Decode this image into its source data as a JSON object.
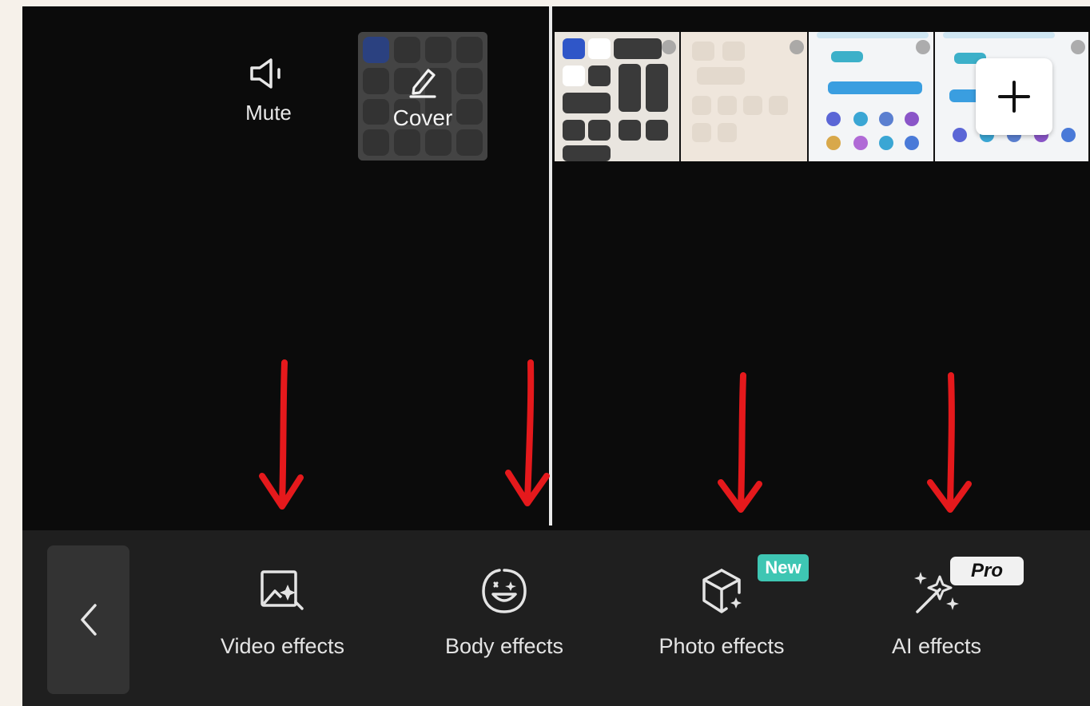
{
  "top_actions": {
    "mute_label": "Mute",
    "cover_label": "Cover"
  },
  "timeline": {
    "add_button": "+"
  },
  "toolbar": {
    "back_icon": "chevron-left-icon",
    "items": [
      {
        "label": "Video effects",
        "icon": "video-effects-icon"
      },
      {
        "label": "Body effects",
        "icon": "body-effects-icon"
      },
      {
        "label": "Photo effects",
        "icon": "photo-effects-icon",
        "badge": "New"
      },
      {
        "label": "AI effects",
        "icon": "ai-effects-icon",
        "badge": "Pro"
      }
    ]
  },
  "colors": {
    "background": "#0b0b0b",
    "toolbar": "#1f1f1f",
    "arrow": "#e5191c",
    "new_badge": "#3ec6b3",
    "pro_badge": "#f1f1f1"
  }
}
